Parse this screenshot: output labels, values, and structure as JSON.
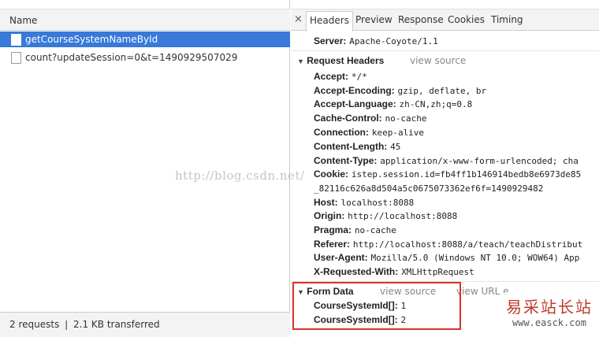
{
  "requests": {
    "column_header": "Name",
    "items": [
      {
        "name": "getCourseSystemNameById",
        "selected": true
      },
      {
        "name": "count?updateSession=0&t=1490929507029",
        "selected": false
      }
    ],
    "status": "2 requests ❘ 2.1 KB transferred"
  },
  "tabs": {
    "close_glyph": "×",
    "items": [
      "Headers",
      "Preview",
      "Response",
      "Cookies",
      "Timing"
    ],
    "active": "Headers"
  },
  "response_header_top": {
    "key": "Server:",
    "value": "Apache-Coyote/1.1"
  },
  "request_headers": {
    "title": "Request Headers",
    "view_source": "view source",
    "items": [
      {
        "key": "Accept:",
        "value": "*/*"
      },
      {
        "key": "Accept-Encoding:",
        "value": "gzip, deflate, br"
      },
      {
        "key": "Accept-Language:",
        "value": "zh-CN,zh;q=0.8"
      },
      {
        "key": "Cache-Control:",
        "value": "no-cache"
      },
      {
        "key": "Connection:",
        "value": "keep-alive"
      },
      {
        "key": "Content-Length:",
        "value": "45"
      },
      {
        "key": "Content-Type:",
        "value": "application/x-www-form-urlencoded; cha"
      },
      {
        "key": "Cookie:",
        "value": "istep.session.id=fb4ff1b146914bedb8e6973de85"
      },
      {
        "key": "",
        "value": "_82116c626a8d504a5c0675073362ef6f=1490929482"
      },
      {
        "key": "Host:",
        "value": "localhost:8088"
      },
      {
        "key": "Origin:",
        "value": "http://localhost:8088"
      },
      {
        "key": "Pragma:",
        "value": "no-cache"
      },
      {
        "key": "Referer:",
        "value": "http://localhost:8088/a/teach/teachDistribut"
      },
      {
        "key": "User-Agent:",
        "value": "Mozilla/5.0 (Windows NT 10.0; WOW64) App"
      },
      {
        "key": "X-Requested-With:",
        "value": "XMLHttpRequest"
      }
    ]
  },
  "form_data": {
    "title": "Form Data",
    "view_source": "view source",
    "view_url_encoded": "view URL e",
    "items": [
      {
        "key": "CourseSystemId[]:",
        "value": "1"
      },
      {
        "key": "CourseSystemId[]:",
        "value": "2"
      }
    ]
  },
  "watermark": "http://blog.csdn.net/",
  "logo": {
    "chinese": "易采站长站",
    "url": "www.easck.com"
  },
  "colors": {
    "selected_row": "#3879d9",
    "highlight_box": "#d9322c"
  }
}
